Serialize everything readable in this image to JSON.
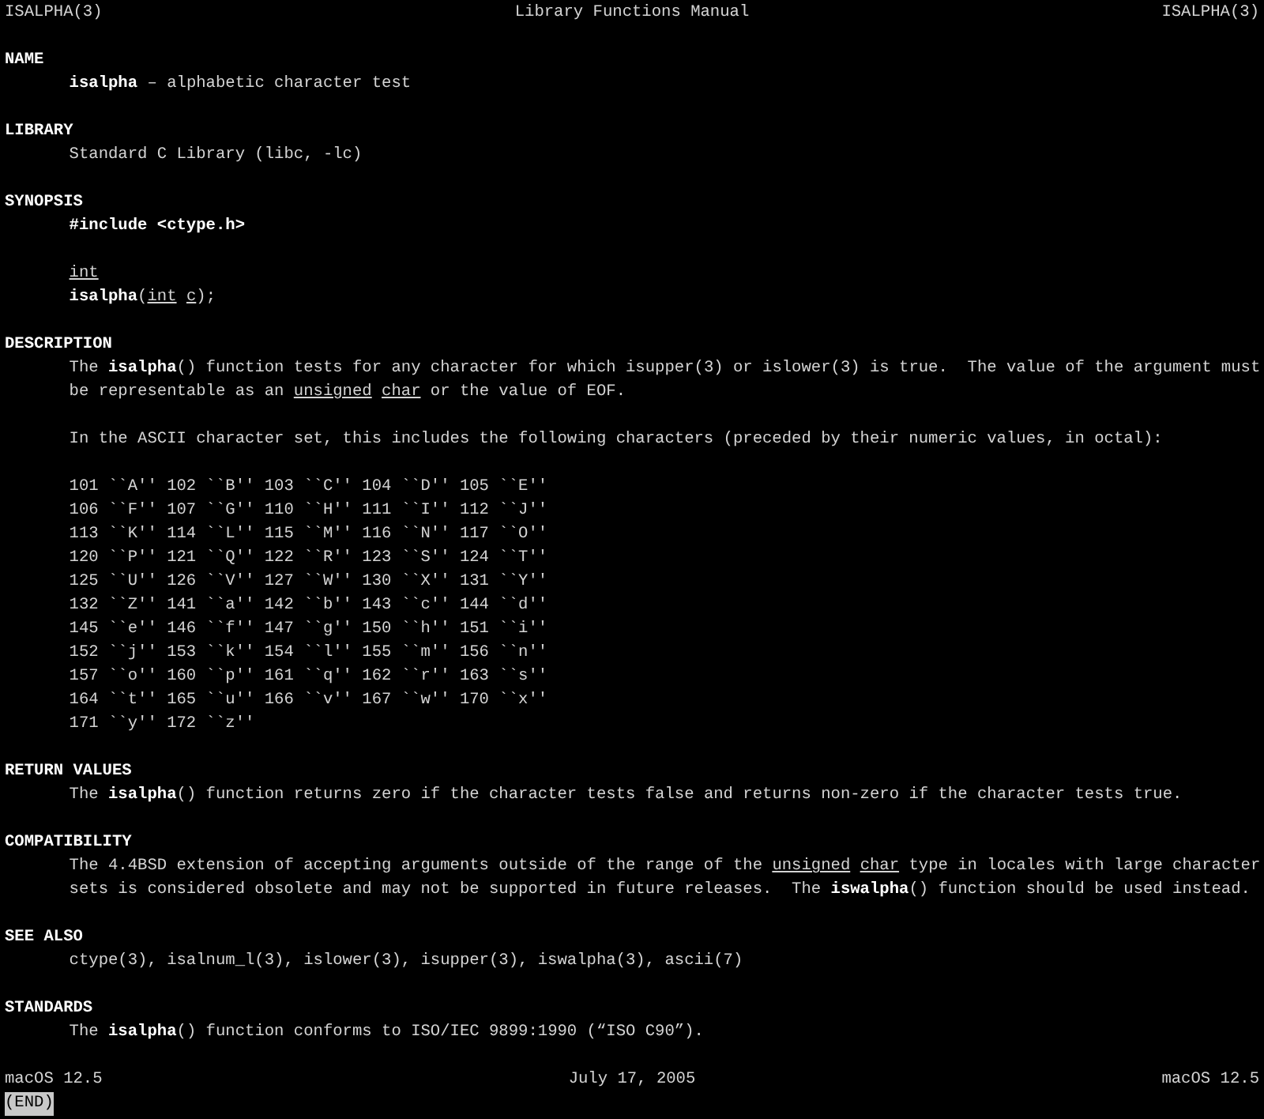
{
  "header": {
    "left": "ISALPHA(3)",
    "center": "Library Functions Manual",
    "right": "ISALPHA(3)"
  },
  "sections": [
    {
      "heading": "NAME",
      "blocks": [
        [
          "**isalpha** – alphabetic character test"
        ]
      ]
    },
    {
      "heading": "LIBRARY",
      "blocks": [
        [
          "Standard C Library (libc, -lc)"
        ]
      ]
    },
    {
      "heading": "SYNOPSIS",
      "blocks": [
        [
          "**#include <ctype.h>**"
        ],
        [
          "*int*",
          "**isalpha**(*int* *c*);"
        ]
      ]
    },
    {
      "heading": "DESCRIPTION",
      "blocks": [
        [
          "The **isalpha**() function tests for any character for which isupper(3) or islower(3) is true.  The value of the argument must",
          "be representable as an *unsigned* *char* or the value of EOF."
        ],
        [
          "In the ASCII character set, this includes the following characters (preceded by their numeric values, in octal):"
        ],
        [
          "101 ``A'' 102 ``B'' 103 ``C'' 104 ``D'' 105 ``E''",
          "106 ``F'' 107 ``G'' 110 ``H'' 111 ``I'' 112 ``J''",
          "113 ``K'' 114 ``L'' 115 ``M'' 116 ``N'' 117 ``O''",
          "120 ``P'' 121 ``Q'' 122 ``R'' 123 ``S'' 124 ``T''",
          "125 ``U'' 126 ``V'' 127 ``W'' 130 ``X'' 131 ``Y''",
          "132 ``Z'' 141 ``a'' 142 ``b'' 143 ``c'' 144 ``d''",
          "145 ``e'' 146 ``f'' 147 ``g'' 150 ``h'' 151 ``i''",
          "152 ``j'' 153 ``k'' 154 ``l'' 155 ``m'' 156 ``n''",
          "157 ``o'' 160 ``p'' 161 ``q'' 162 ``r'' 163 ``s''",
          "164 ``t'' 165 ``u'' 166 ``v'' 167 ``w'' 170 ``x''",
          "171 ``y'' 172 ``z''"
        ]
      ]
    },
    {
      "heading": "RETURN VALUES",
      "blocks": [
        [
          "The **isalpha**() function returns zero if the character tests false and returns non-zero if the character tests true."
        ]
      ]
    },
    {
      "heading": "COMPATIBILITY",
      "blocks": [
        [
          "The 4.4BSD extension of accepting arguments outside of the range of the *unsigned* *char* type in locales with large character",
          "sets is considered obsolete and may not be supported in future releases.  The **iswalpha**() function should be used instead."
        ]
      ]
    },
    {
      "heading": "SEE ALSO",
      "blocks": [
        [
          "ctype(3), isalnum_l(3), islower(3), isupper(3), iswalpha(3), ascii(7)"
        ]
      ]
    },
    {
      "heading": "STANDARDS",
      "blocks": [
        [
          "The **isalpha**() function conforms to ISO/IEC 9899:1990 (“ISO C90”)."
        ]
      ]
    }
  ],
  "footer": {
    "left": "macOS 12.5",
    "center": "July 17, 2005",
    "right": "macOS 12.5"
  },
  "pager_status": "(END)"
}
